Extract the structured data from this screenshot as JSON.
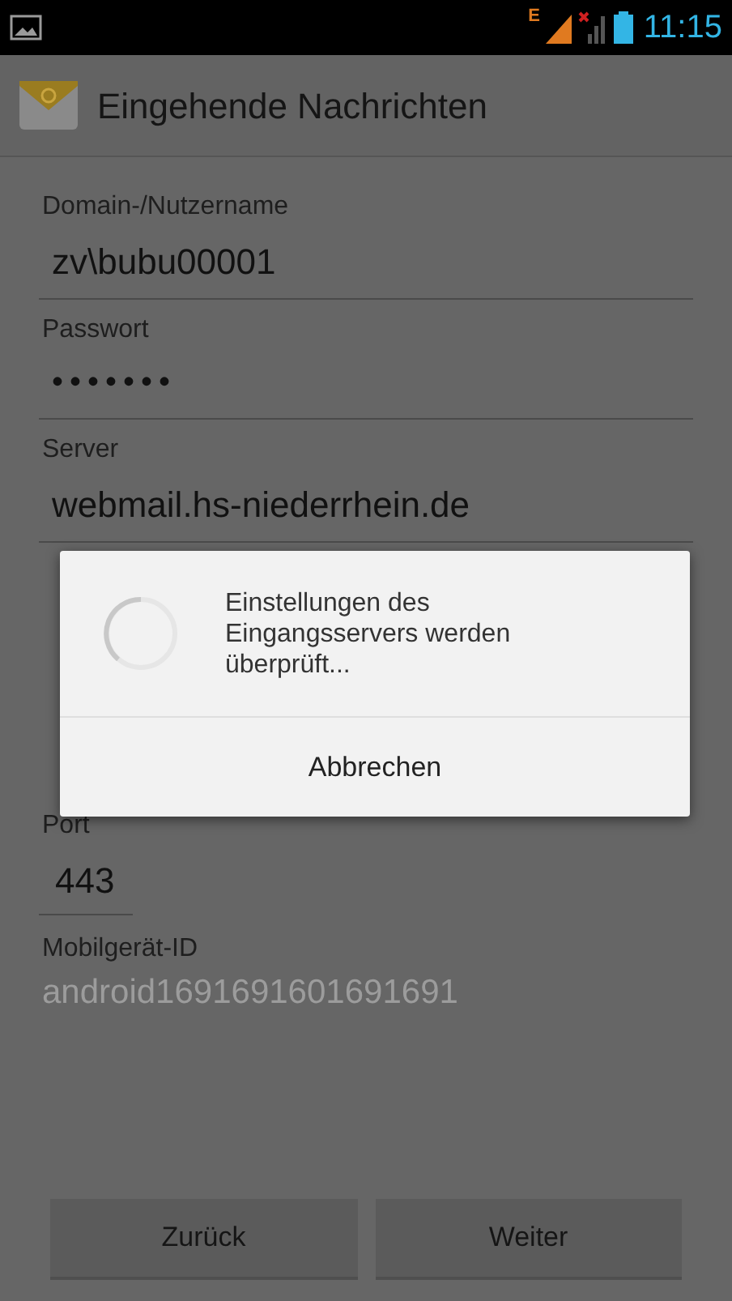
{
  "status_bar": {
    "time": "11:15",
    "network": "E"
  },
  "action_bar": {
    "title": "Eingehende Nachrichten"
  },
  "fields": [
    {
      "kind": "text",
      "label": "Domain-/Nutzername",
      "value": "zv\\bubu00001"
    },
    {
      "kind": "password",
      "label": "Passwort",
      "value": "•••••••"
    },
    {
      "kind": "text",
      "label": "Server",
      "value": "webmail.hs-niederrhein.de"
    },
    {
      "kind": "hidden"
    },
    {
      "kind": "short",
      "label": "Port",
      "value": "443"
    },
    {
      "kind": "readonly",
      "label": "Mobilgerät-ID",
      "value": "android1691691601691691"
    }
  ],
  "dialog": {
    "message": "Einstellungen des Eingangsservers werden überprüft...",
    "button": "Abbrechen"
  },
  "buttons": [
    "Zurück",
    "Weiter"
  ]
}
